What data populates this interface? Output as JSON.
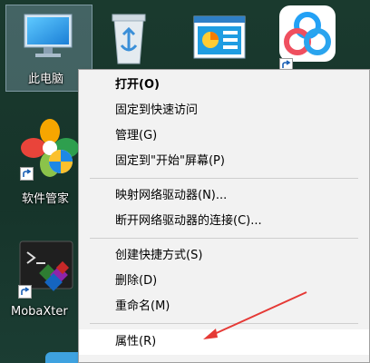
{
  "desktop": {
    "icons": [
      {
        "label": "此电脑",
        "icon": "this-pc-icon"
      },
      {
        "label": "",
        "icon": "recycle-bin-icon"
      },
      {
        "label": "",
        "icon": "control-panel-icon"
      },
      {
        "label": "",
        "icon": "baidu-netdisk-icon"
      },
      {
        "label": "软件管家",
        "icon": "software-manager-icon"
      },
      {
        "label": "MobaXter",
        "icon": "mobaxterm-icon"
      }
    ]
  },
  "context_menu": {
    "groups": [
      [
        {
          "label": "打开(O)",
          "bold": true
        },
        {
          "label": "固定到快速访问"
        },
        {
          "label": "管理(G)"
        },
        {
          "label": "固定到\"开始\"屏幕(P)"
        }
      ],
      [
        {
          "label": "映射网络驱动器(N)..."
        },
        {
          "label": "断开网络驱动器的连接(C)..."
        }
      ],
      [
        {
          "label": "创建快捷方式(S)"
        },
        {
          "label": "删除(D)"
        },
        {
          "label": "重命名(M)"
        }
      ],
      [
        {
          "label": "属性(R)",
          "hover": true
        }
      ]
    ]
  },
  "annotation": {
    "color": "#e53935",
    "icon": "red-arrow-annotation"
  }
}
